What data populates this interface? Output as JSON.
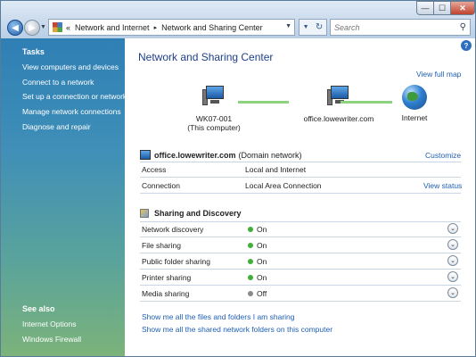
{
  "window": {
    "controls": {
      "minimize": "—",
      "maximize": "☐",
      "close": "✕"
    }
  },
  "address": {
    "prefix": "«",
    "crumbs": [
      "Network and Internet",
      "Network and Sharing Center"
    ],
    "separator": "▸"
  },
  "search": {
    "placeholder": "Search"
  },
  "sidebar": {
    "tasks_heading": "Tasks",
    "tasks": [
      "View computers and devices",
      "Connect to a network",
      "Set up a connection or network",
      "Manage network connections",
      "Diagnose and repair"
    ],
    "see_also_heading": "See also",
    "see_also": [
      "Internet Options",
      "Windows Firewall"
    ]
  },
  "main": {
    "title": "Network and Sharing Center",
    "view_full_map": "View full map",
    "map": {
      "computer_name": "WK07-001",
      "computer_sub": "(This computer)",
      "domain": "office.lowewriter.com",
      "internet": "Internet"
    },
    "network": {
      "name": "office.lowewriter.com",
      "type": "(Domain network)",
      "customize": "Customize",
      "rows": [
        {
          "label": "Access",
          "value": "Local and Internet"
        },
        {
          "label": "Connection",
          "value": "Local Area Connection"
        }
      ],
      "view_status": "View status"
    },
    "sharing": {
      "title": "Sharing and Discovery",
      "items": [
        {
          "label": "Network discovery",
          "state": "On",
          "color": "#3fae3a"
        },
        {
          "label": "File sharing",
          "state": "On",
          "color": "#3fae3a"
        },
        {
          "label": "Public folder sharing",
          "state": "On",
          "color": "#3fae3a"
        },
        {
          "label": "Printer sharing",
          "state": "On",
          "color": "#3fae3a"
        },
        {
          "label": "Media sharing",
          "state": "Off",
          "color": "#8a8a8a"
        }
      ]
    },
    "bottom_links": [
      "Show me all the files and folders I am sharing",
      "Show me all the shared network folders on this computer"
    ]
  }
}
